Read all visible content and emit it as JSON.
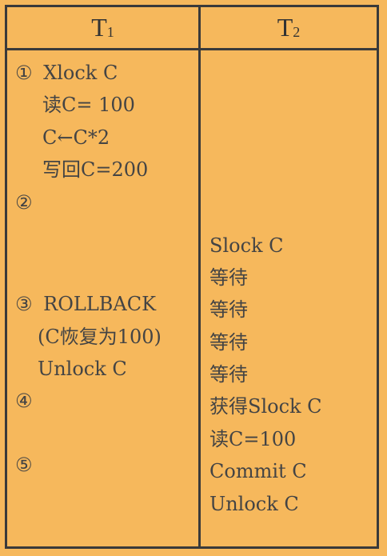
{
  "header": {
    "t1_letter": "T",
    "t1_sub": "1",
    "t2_letter": "T",
    "t2_sub": "2"
  },
  "t1": {
    "step1": "①",
    "xlock": "Xlock C",
    "read": "读C= 100",
    "assign": "C←C*2",
    "writeback": "写回C=200",
    "step2": "②",
    "step3": "③",
    "rollback": "ROLLBACK",
    "restore": "(C恢复为100)",
    "unlock": "Unlock C",
    "step4": "④",
    "step5": "⑤"
  },
  "t2": {
    "slock": "Slock C",
    "wait1": "等待",
    "wait2": "等待",
    "wait3": "等待",
    "wait4": "等待",
    "obtain": "获得Slock C",
    "read": "读C=100",
    "commit": "Commit C",
    "unlock": "Unlock C"
  }
}
